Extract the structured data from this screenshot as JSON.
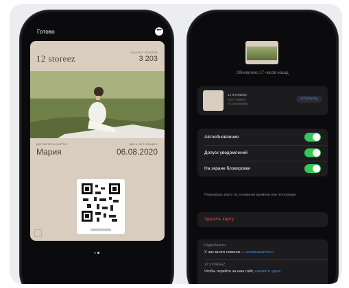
{
  "left_phone": {
    "done_label": "Готово",
    "more_icon": "ellipsis-circle-icon",
    "pass": {
      "brand": "12 storeez",
      "balance_label": "БАЛАНС БАЛЛОВ",
      "balance_value": "3 203",
      "holder_label": "ДЕРЖАТЕЛЬ КАРТЫ",
      "holder_value": "Мария",
      "activation_label": "ДАТА АКТИВАЦИИ",
      "activation_value": "06.08.2020",
      "colors": {
        "card": "#d8cdbf",
        "text": "#4a4036"
      }
    },
    "page_dots": {
      "count": 2,
      "active": 2
    }
  },
  "right_phone": {
    "updated_text": "Обновлено 17 часов назад",
    "pass_card": {
      "name": "12 STOREEZ",
      "sub1": "ЗОО ТОВАРЫ",
      "sub2": "УСТАНОВЛЕНО",
      "open_label": "ОТКРЫТЬ"
    },
    "settings": {
      "auto_update": {
        "label": "Автообновление",
        "on": true
      },
      "notifications": {
        "label": "Допуск уведомлений",
        "on": true
      },
      "lock_screen": {
        "label": "На экране блокировки",
        "on": true
      }
    },
    "hint": "Показывать карту на основании времени или геопозиции.",
    "remove_label": "Удалить карту",
    "details": {
      "title": "Подробности",
      "text_prefix": "У нас много новинок — ",
      "text_link": "возвращайтесь!",
      "brand_title": "12 STOREEZ",
      "brand_text_prefix": "Чтобы перейти на наш сайт, ",
      "brand_text_link": "нажмите здесь"
    },
    "accent_color": "#34c759",
    "link_color": "#3b82f6",
    "destructive_color": "#ff453a"
  }
}
